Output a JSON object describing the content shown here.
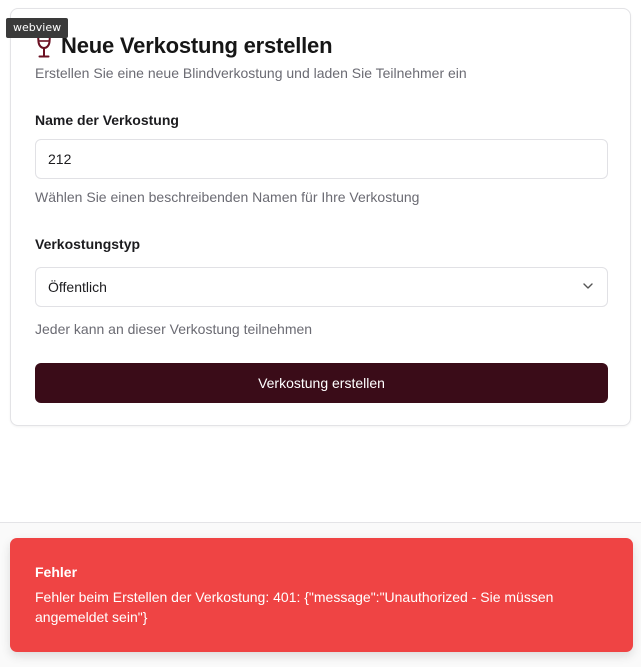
{
  "badge": {
    "label": "webview"
  },
  "form": {
    "title": "Neue Verkostung erstellen",
    "subtitle": "Erstellen Sie eine neue Blindverkostung und laden Sie Teilnehmer ein",
    "name_field": {
      "label": "Name der Verkostung",
      "value": "212",
      "hint": "Wählen Sie einen beschreibenden Namen für Ihre Verkostung"
    },
    "type_field": {
      "label": "Verkostungstyp",
      "selected": "Öffentlich",
      "hint": "Jeder kann an dieser Verkostung teilnehmen"
    },
    "submit_label": "Verkostung erstellen"
  },
  "toast": {
    "title": "Fehler",
    "message": "Fehler beim Erstellen der Verkostung: 401: {\"message\":\"Unauthorized - Sie müssen angemeldet sein\"}"
  },
  "icons": {
    "title_icon": "wine-glass-icon",
    "select_icon": "chevron-down-icon"
  },
  "colors": {
    "accent": "#3a0c18",
    "icon": "#6b1022",
    "error": "#ef4444"
  }
}
